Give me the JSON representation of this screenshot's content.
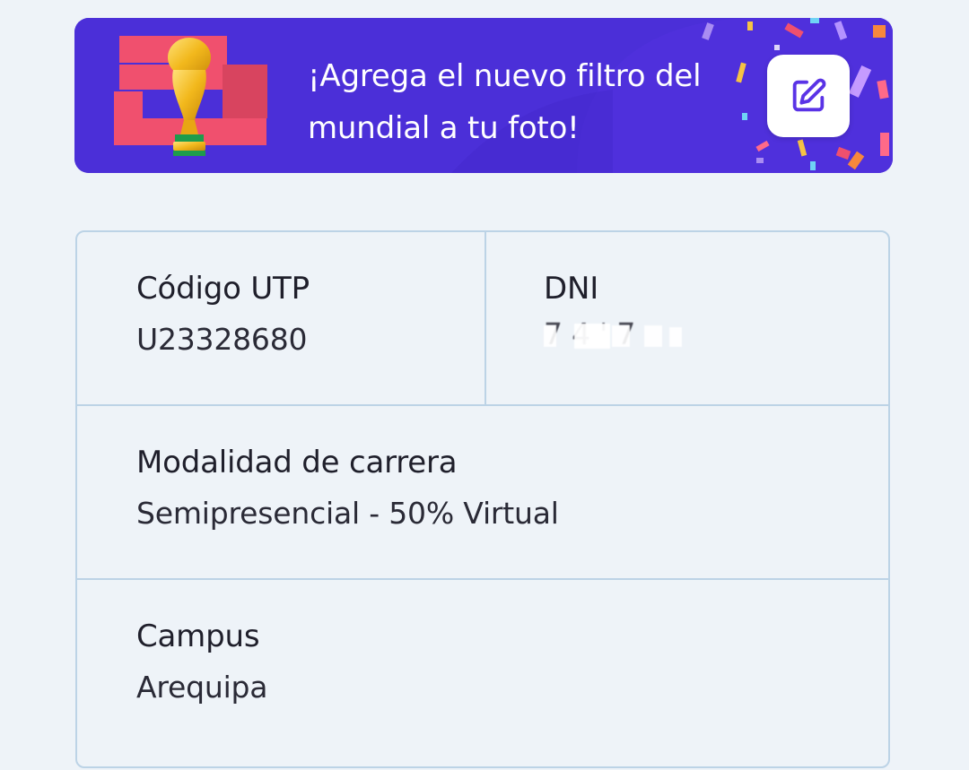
{
  "banner": {
    "title": "¡Agrega el nuevo filtro del\nmundial a tu foto!",
    "background_color": "#4b2fd8",
    "accent_color": "#f0506e",
    "edit_icon": "edit-square-icon",
    "trophy_icon": "world-cup-trophy-icon"
  },
  "info": {
    "codigo": {
      "label": "Código UTP",
      "value": "U23328680"
    },
    "dni": {
      "label": "DNI",
      "value": "7  4 ' 7"
    },
    "modalidad": {
      "label": "Modalidad de carrera",
      "value": "Semipresencial - 50% Virtual"
    },
    "campus": {
      "label": "Campus",
      "value": "Arequipa"
    }
  },
  "colors": {
    "page_background": "#eef3f8",
    "card_border": "#bcd3e6",
    "text": "#1f1f2b"
  }
}
